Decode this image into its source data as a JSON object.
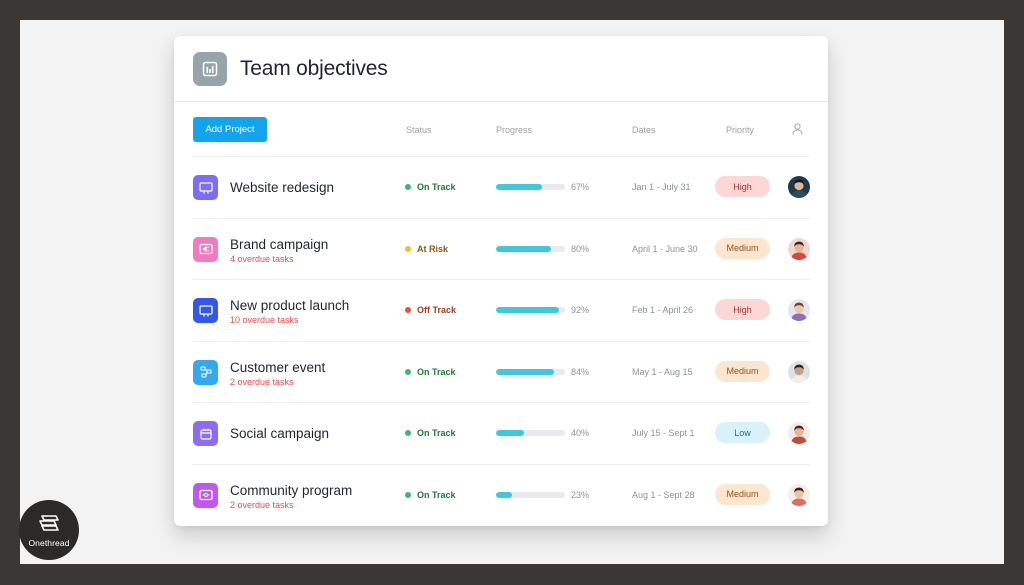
{
  "header": {
    "title": "Team objectives",
    "icon": "bar-chart-icon"
  },
  "toolbar": {
    "add_label": "Add Project"
  },
  "columns": {
    "status": "Status",
    "progress": "Progress",
    "dates": "Dates",
    "priority": "Priority",
    "owner_icon": "person-icon"
  },
  "colors": {
    "accent": "#12a4ec",
    "on_track": "#3bb86a",
    "at_risk": "#f2c025",
    "off_track": "#ef4a3a",
    "progress": "#3ec7e0"
  },
  "projects": [
    {
      "name": "Website redesign",
      "overdue": "",
      "icon": "browser-icon",
      "icon_color": "#7b6ef6",
      "status": "On Track",
      "status_color": "#3bb86a",
      "status_text_color": "#1f7a38",
      "progress": 67,
      "progress_label": "67%",
      "dates": "Jan 1 - July 31",
      "priority": "High",
      "priority_bg": "#fdd6d6",
      "priority_color": "#9a3434",
      "avatar": "avatar-man-dark-hair"
    },
    {
      "name": "Brand campaign",
      "overdue": "4 overdue tasks",
      "icon": "megaphone-icon",
      "icon_color": "#f27ac1",
      "status": "At Risk",
      "status_color": "#f2c025",
      "status_text_color": "#8a5a12",
      "progress": 80,
      "progress_label": "80%",
      "dates": "April 1 - June 30",
      "priority": "Medium",
      "priority_bg": "#fde6cf",
      "priority_color": "#8a5420",
      "avatar": "avatar-man-red-shirt"
    },
    {
      "name": "New product launch",
      "overdue": "10 overdue tasks",
      "icon": "launch-icon",
      "icon_color": "#3357e6",
      "status": "Off Track",
      "status_color": "#ef4a3a",
      "status_text_color": "#a33a22",
      "progress": 92,
      "progress_label": "92%",
      "dates": "Feb 1 - April 26",
      "priority": "High",
      "priority_bg": "#fdd6d6",
      "priority_color": "#9a3434",
      "avatar": "avatar-woman-long-hair"
    },
    {
      "name": "Customer event",
      "overdue": "2 overdue tasks",
      "icon": "event-icon",
      "icon_color": "#35a9f0",
      "status": "On Track",
      "status_color": "#3bb86a",
      "status_text_color": "#1f7a38",
      "progress": 84,
      "progress_label": "84%",
      "dates": "May 1 - Aug 15",
      "priority": "Medium",
      "priority_bg": "#fde6cf",
      "priority_color": "#8a5420",
      "avatar": "avatar-man-light-shirt"
    },
    {
      "name": "Social campaign",
      "overdue": "",
      "icon": "calendar-icon",
      "icon_color": "#8c6cf2",
      "status": "On Track",
      "status_color": "#3bb86a",
      "status_text_color": "#1f7a38",
      "progress": 40,
      "progress_label": "40%",
      "dates": "July 15 - Sept 1",
      "priority": "Low",
      "priority_bg": "#d8f1fb",
      "priority_color": "#266e8a",
      "avatar": "avatar-woman-dark-hair"
    },
    {
      "name": "Community program",
      "overdue": "2 overdue tasks",
      "icon": "community-icon",
      "icon_color": "#c058f0",
      "status": "On Track",
      "status_color": "#3bb86a",
      "status_text_color": "#1f7a38",
      "progress": 23,
      "progress_label": "23%",
      "dates": "Aug 1 - Sept 28",
      "priority": "Medium",
      "priority_bg": "#fde6cf",
      "priority_color": "#8a5420",
      "avatar": "avatar-woman-smiling"
    }
  ],
  "watermark": {
    "text": "Onethread",
    "icon": "onethread-logo-icon"
  }
}
